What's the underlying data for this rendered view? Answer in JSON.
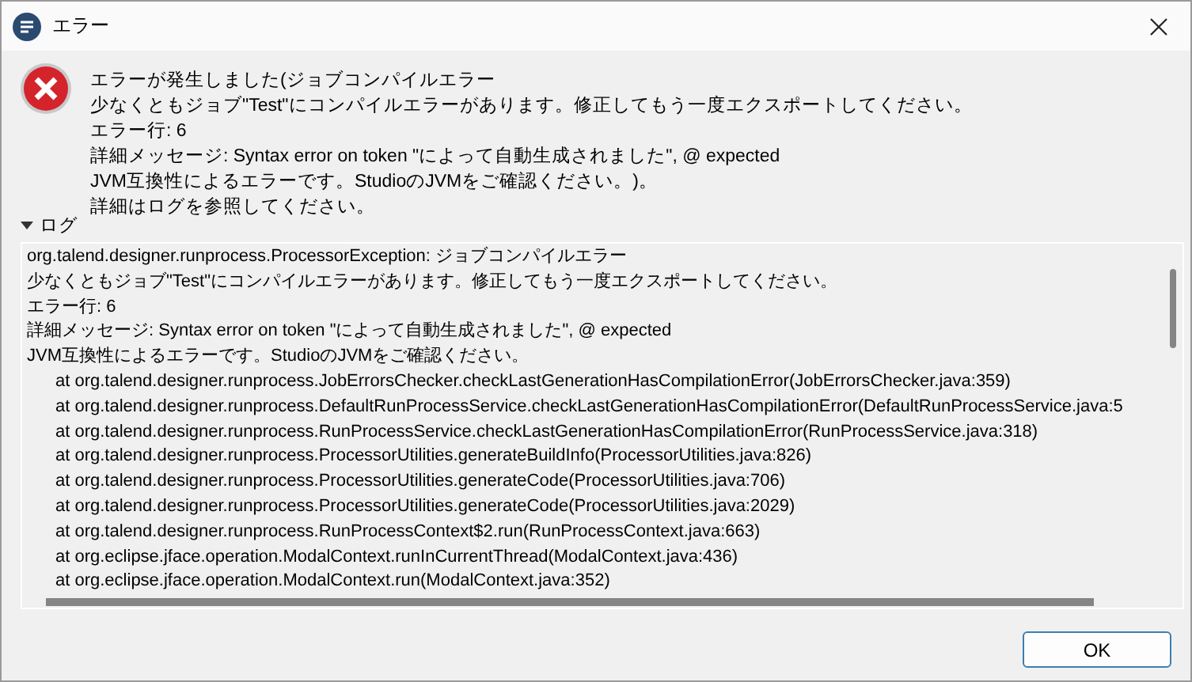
{
  "window": {
    "title": "エラー"
  },
  "message": {
    "lines": [
      "エラーが発生しました(ジョブコンパイルエラー",
      "少なくともジョブ\"Test\"にコンパイルエラーがあります。修正してもう一度エクスポートしてください。",
      "エラー行: 6",
      "詳細メッセージ: Syntax error on token \"によって自動生成されました\", @ expected",
      "JVM互換性によるエラーです。StudioのJVMをご確認ください。)。",
      "詳細はログを参照してください。"
    ]
  },
  "log": {
    "label": "ログ",
    "expanded": true,
    "lines": [
      {
        "kind": "message",
        "text": "org.talend.designer.runprocess.ProcessorException: ジョブコンパイルエラー"
      },
      {
        "kind": "message",
        "text": "少なくともジョブ\"Test\"にコンパイルエラーがあります。修正してもう一度エクスポートしてください。"
      },
      {
        "kind": "message",
        "text": "エラー行: 6"
      },
      {
        "kind": "message",
        "text": "詳細メッセージ: Syntax error on token \"によって自動生成されました\", @ expected"
      },
      {
        "kind": "message",
        "text": "JVM互換性によるエラーです。StudioのJVMをご確認ください。"
      },
      {
        "kind": "frame",
        "text": "at org.talend.designer.runprocess.JobErrorsChecker.checkLastGenerationHasCompilationError(JobErrorsChecker.java:359)"
      },
      {
        "kind": "frame",
        "text": "at org.talend.designer.runprocess.DefaultRunProcessService.checkLastGenerationHasCompilationError(DefaultRunProcessService.java:5"
      },
      {
        "kind": "frame",
        "text": "at org.talend.designer.runprocess.RunProcessService.checkLastGenerationHasCompilationError(RunProcessService.java:318)"
      },
      {
        "kind": "frame",
        "text": "at org.talend.designer.runprocess.ProcessorUtilities.generateBuildInfo(ProcessorUtilities.java:826)"
      },
      {
        "kind": "frame",
        "text": "at org.talend.designer.runprocess.ProcessorUtilities.generateCode(ProcessorUtilities.java:706)"
      },
      {
        "kind": "frame",
        "text": "at org.talend.designer.runprocess.ProcessorUtilities.generateCode(ProcessorUtilities.java:2029)"
      },
      {
        "kind": "frame",
        "text": "at org.talend.designer.runprocess.RunProcessContext$2.run(RunProcessContext.java:663)"
      },
      {
        "kind": "frame",
        "text": "at org.eclipse.jface.operation.ModalContext.runInCurrentThread(ModalContext.java:436)"
      },
      {
        "kind": "frame",
        "text": "at org.eclipse.jface.operation.ModalContext.run(ModalContext.java:352)"
      }
    ]
  },
  "buttons": [
    "OK"
  ]
}
